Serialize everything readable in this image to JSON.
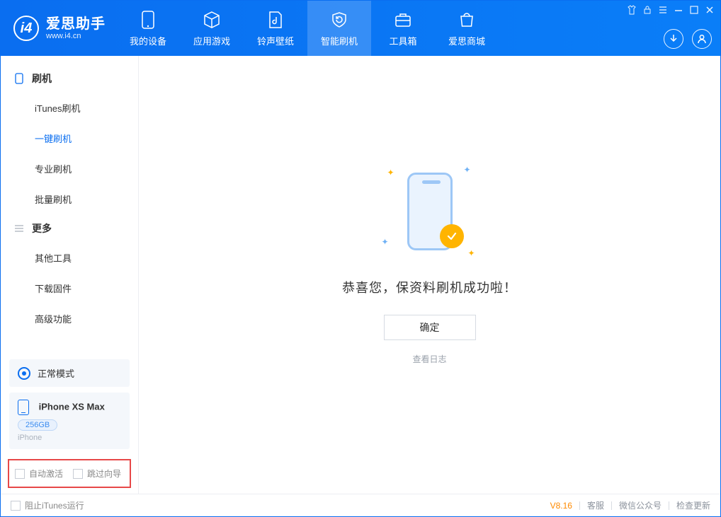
{
  "app": {
    "name": "爱思助手",
    "site": "www.i4.cn"
  },
  "nav": {
    "device": "我的设备",
    "apps": "应用游戏",
    "ring": "铃声壁纸",
    "flash": "智能刷机",
    "toolbox": "工具箱",
    "store": "爱思商城"
  },
  "sidebar": {
    "group_flash": "刷机",
    "items_flash": {
      "itunes": "iTunes刷机",
      "oneclick": "一键刷机",
      "pro": "专业刷机",
      "batch": "批量刷机"
    },
    "group_more": "更多",
    "items_more": {
      "other": "其他工具",
      "firmware": "下载固件",
      "advanced": "高级功能"
    }
  },
  "device_panel": {
    "mode": "正常模式",
    "name": "iPhone XS Max",
    "capacity": "256GB",
    "type": "iPhone"
  },
  "options": {
    "auto_activate": "自动激活",
    "skip_guide": "跳过向导"
  },
  "main": {
    "message": "恭喜您，保资料刷机成功啦！",
    "ok": "确定",
    "view_log": "查看日志"
  },
  "footer": {
    "block_itunes": "阻止iTunes运行",
    "version": "V8.16",
    "service": "客服",
    "wechat": "微信公众号",
    "update": "检查更新"
  }
}
